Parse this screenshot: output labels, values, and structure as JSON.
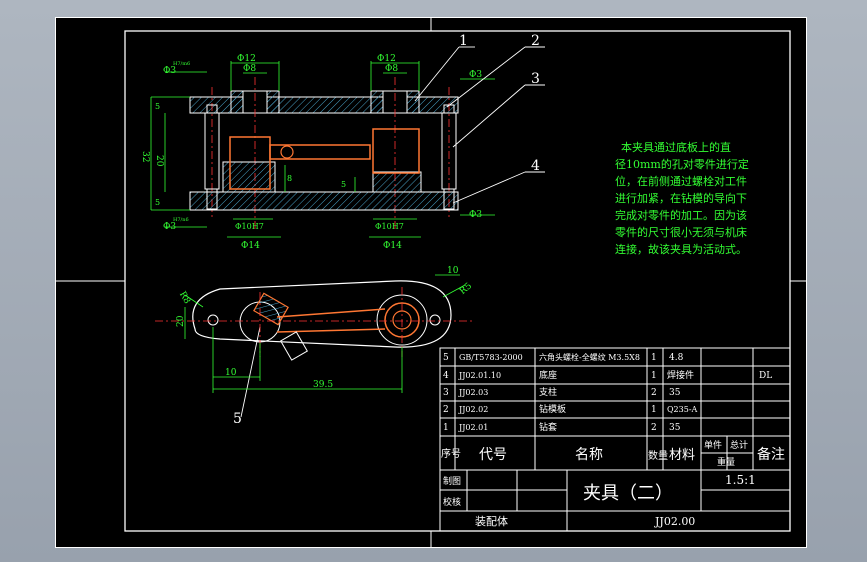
{
  "balloons": [
    "1",
    "2",
    "3",
    "4",
    "5"
  ],
  "dims": {
    "d12_left": "Φ12",
    "d8_left": "Φ8",
    "d12_right": "Φ12",
    "d8_right": "Φ8",
    "d3_tl": "Φ3",
    "d3_tr": "Φ3",
    "d3_bl": "Φ3",
    "d3_br": "Φ3",
    "fit_h7m6": "H7/m6",
    "fit_h7n6": "H7/n6",
    "d10_left": "Φ10H7",
    "d10_right": "Φ10H7",
    "d14_left": "Φ14",
    "d14_right": "Φ14",
    "h32": "32",
    "h20": "20",
    "h5a": "5",
    "h5b": "5",
    "h8": "8",
    "h5c": "5",
    "r10": "10",
    "r5": "R5",
    "r8": "R8",
    "w20": "20",
    "w10": "10",
    "w395": "39.5"
  },
  "note": {
    "lines": [
      "本夹具通过底板上的直",
      "径10mm的孔对零件进行定",
      "位，在前侧通过螺栓对工件",
      "进行加紧，在钻模的导向下",
      "完成对零件的加工。因为该",
      "零件的尺寸很小无须与机床",
      "连接，故该夹具为活动式。"
    ]
  },
  "bom": {
    "rows": [
      {
        "no": "5",
        "code": "GB/T5783-2000",
        "name": "六角头螺栓-全螺纹 M3.5X8",
        "qty": "1",
        "mat": "4.8",
        "note": ""
      },
      {
        "no": "4",
        "code": "JJ02.01.10",
        "name": "底座",
        "qty": "1",
        "mat": "焊接件",
        "note": "DL"
      },
      {
        "no": "3",
        "code": "JJ02.03",
        "name": "支柱",
        "qty": "2",
        "mat": "35",
        "note": ""
      },
      {
        "no": "2",
        "code": "JJ02.02",
        "name": "钻模板",
        "qty": "1",
        "mat": "Q235-A",
        "note": ""
      },
      {
        "no": "1",
        "code": "JJ02.01",
        "name": "钻套",
        "qty": "2",
        "mat": "35",
        "note": ""
      }
    ],
    "header": {
      "no": "序号",
      "code": "代号",
      "name": "名称",
      "qty": "数量",
      "mat": "材料",
      "single": "单件",
      "total": "总计",
      "weight": "重量",
      "note": "备注"
    }
  },
  "title_block": {
    "title": "夹具（二）",
    "scale": "1.5:1",
    "draw_label": "制图",
    "check_label": "校核",
    "assembly_label": "装配体",
    "drawing_no": "JJ02.00"
  },
  "colors": {
    "background": "#000000",
    "line": "#ffffff",
    "dimension": "#33ff33",
    "part": "#ff7733",
    "hatch": "#66ccff"
  }
}
